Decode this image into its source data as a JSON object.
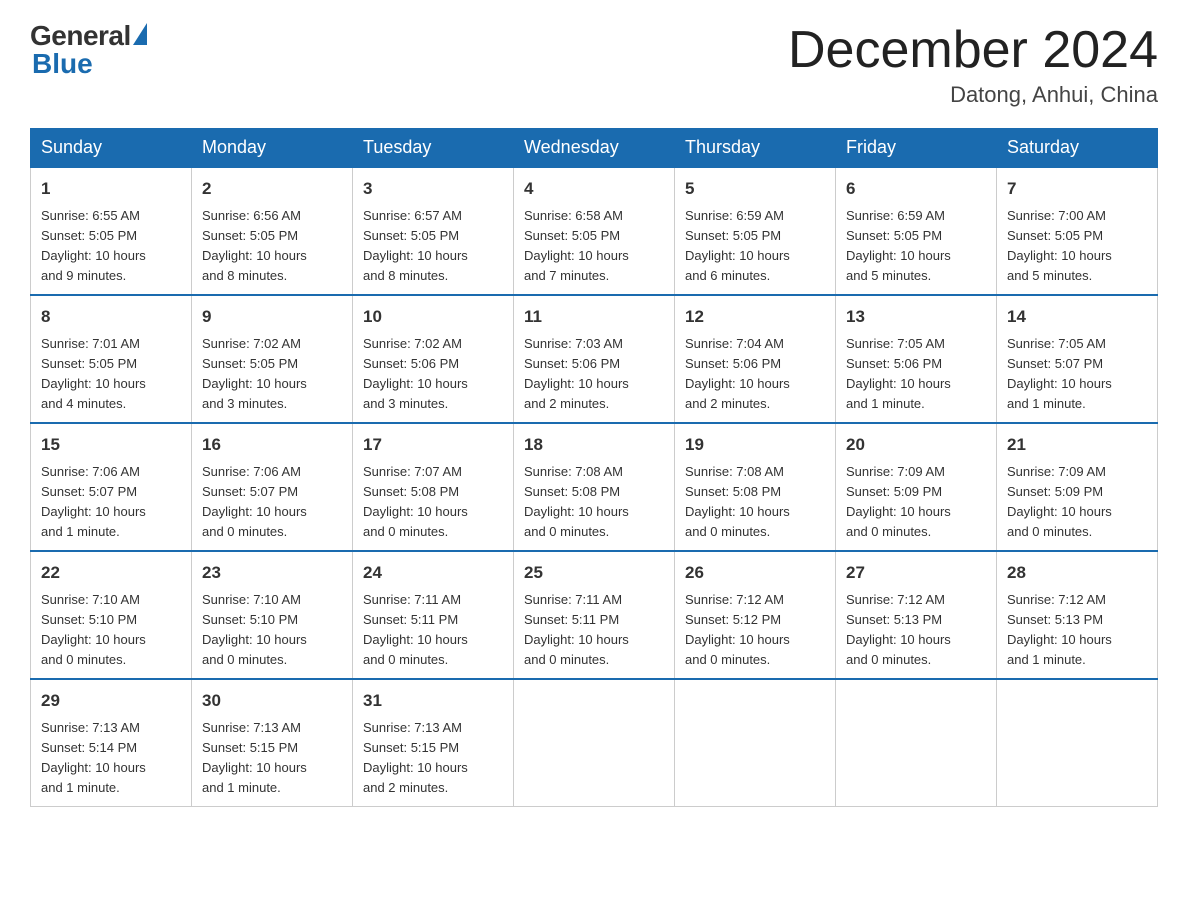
{
  "logo": {
    "general": "General",
    "blue": "Blue"
  },
  "title": "December 2024",
  "location": "Datong, Anhui, China",
  "days_of_week": [
    "Sunday",
    "Monday",
    "Tuesday",
    "Wednesday",
    "Thursday",
    "Friday",
    "Saturday"
  ],
  "weeks": [
    [
      {
        "day": "1",
        "info": "Sunrise: 6:55 AM\nSunset: 5:05 PM\nDaylight: 10 hours\nand 9 minutes."
      },
      {
        "day": "2",
        "info": "Sunrise: 6:56 AM\nSunset: 5:05 PM\nDaylight: 10 hours\nand 8 minutes."
      },
      {
        "day": "3",
        "info": "Sunrise: 6:57 AM\nSunset: 5:05 PM\nDaylight: 10 hours\nand 8 minutes."
      },
      {
        "day": "4",
        "info": "Sunrise: 6:58 AM\nSunset: 5:05 PM\nDaylight: 10 hours\nand 7 minutes."
      },
      {
        "day": "5",
        "info": "Sunrise: 6:59 AM\nSunset: 5:05 PM\nDaylight: 10 hours\nand 6 minutes."
      },
      {
        "day": "6",
        "info": "Sunrise: 6:59 AM\nSunset: 5:05 PM\nDaylight: 10 hours\nand 5 minutes."
      },
      {
        "day": "7",
        "info": "Sunrise: 7:00 AM\nSunset: 5:05 PM\nDaylight: 10 hours\nand 5 minutes."
      }
    ],
    [
      {
        "day": "8",
        "info": "Sunrise: 7:01 AM\nSunset: 5:05 PM\nDaylight: 10 hours\nand 4 minutes."
      },
      {
        "day": "9",
        "info": "Sunrise: 7:02 AM\nSunset: 5:05 PM\nDaylight: 10 hours\nand 3 minutes."
      },
      {
        "day": "10",
        "info": "Sunrise: 7:02 AM\nSunset: 5:06 PM\nDaylight: 10 hours\nand 3 minutes."
      },
      {
        "day": "11",
        "info": "Sunrise: 7:03 AM\nSunset: 5:06 PM\nDaylight: 10 hours\nand 2 minutes."
      },
      {
        "day": "12",
        "info": "Sunrise: 7:04 AM\nSunset: 5:06 PM\nDaylight: 10 hours\nand 2 minutes."
      },
      {
        "day": "13",
        "info": "Sunrise: 7:05 AM\nSunset: 5:06 PM\nDaylight: 10 hours\nand 1 minute."
      },
      {
        "day": "14",
        "info": "Sunrise: 7:05 AM\nSunset: 5:07 PM\nDaylight: 10 hours\nand 1 minute."
      }
    ],
    [
      {
        "day": "15",
        "info": "Sunrise: 7:06 AM\nSunset: 5:07 PM\nDaylight: 10 hours\nand 1 minute."
      },
      {
        "day": "16",
        "info": "Sunrise: 7:06 AM\nSunset: 5:07 PM\nDaylight: 10 hours\nand 0 minutes."
      },
      {
        "day": "17",
        "info": "Sunrise: 7:07 AM\nSunset: 5:08 PM\nDaylight: 10 hours\nand 0 minutes."
      },
      {
        "day": "18",
        "info": "Sunrise: 7:08 AM\nSunset: 5:08 PM\nDaylight: 10 hours\nand 0 minutes."
      },
      {
        "day": "19",
        "info": "Sunrise: 7:08 AM\nSunset: 5:08 PM\nDaylight: 10 hours\nand 0 minutes."
      },
      {
        "day": "20",
        "info": "Sunrise: 7:09 AM\nSunset: 5:09 PM\nDaylight: 10 hours\nand 0 minutes."
      },
      {
        "day": "21",
        "info": "Sunrise: 7:09 AM\nSunset: 5:09 PM\nDaylight: 10 hours\nand 0 minutes."
      }
    ],
    [
      {
        "day": "22",
        "info": "Sunrise: 7:10 AM\nSunset: 5:10 PM\nDaylight: 10 hours\nand 0 minutes."
      },
      {
        "day": "23",
        "info": "Sunrise: 7:10 AM\nSunset: 5:10 PM\nDaylight: 10 hours\nand 0 minutes."
      },
      {
        "day": "24",
        "info": "Sunrise: 7:11 AM\nSunset: 5:11 PM\nDaylight: 10 hours\nand 0 minutes."
      },
      {
        "day": "25",
        "info": "Sunrise: 7:11 AM\nSunset: 5:11 PM\nDaylight: 10 hours\nand 0 minutes."
      },
      {
        "day": "26",
        "info": "Sunrise: 7:12 AM\nSunset: 5:12 PM\nDaylight: 10 hours\nand 0 minutes."
      },
      {
        "day": "27",
        "info": "Sunrise: 7:12 AM\nSunset: 5:13 PM\nDaylight: 10 hours\nand 0 minutes."
      },
      {
        "day": "28",
        "info": "Sunrise: 7:12 AM\nSunset: 5:13 PM\nDaylight: 10 hours\nand 1 minute."
      }
    ],
    [
      {
        "day": "29",
        "info": "Sunrise: 7:13 AM\nSunset: 5:14 PM\nDaylight: 10 hours\nand 1 minute."
      },
      {
        "day": "30",
        "info": "Sunrise: 7:13 AM\nSunset: 5:15 PM\nDaylight: 10 hours\nand 1 minute."
      },
      {
        "day": "31",
        "info": "Sunrise: 7:13 AM\nSunset: 5:15 PM\nDaylight: 10 hours\nand 2 minutes."
      },
      {
        "day": "",
        "info": ""
      },
      {
        "day": "",
        "info": ""
      },
      {
        "day": "",
        "info": ""
      },
      {
        "day": "",
        "info": ""
      }
    ]
  ]
}
